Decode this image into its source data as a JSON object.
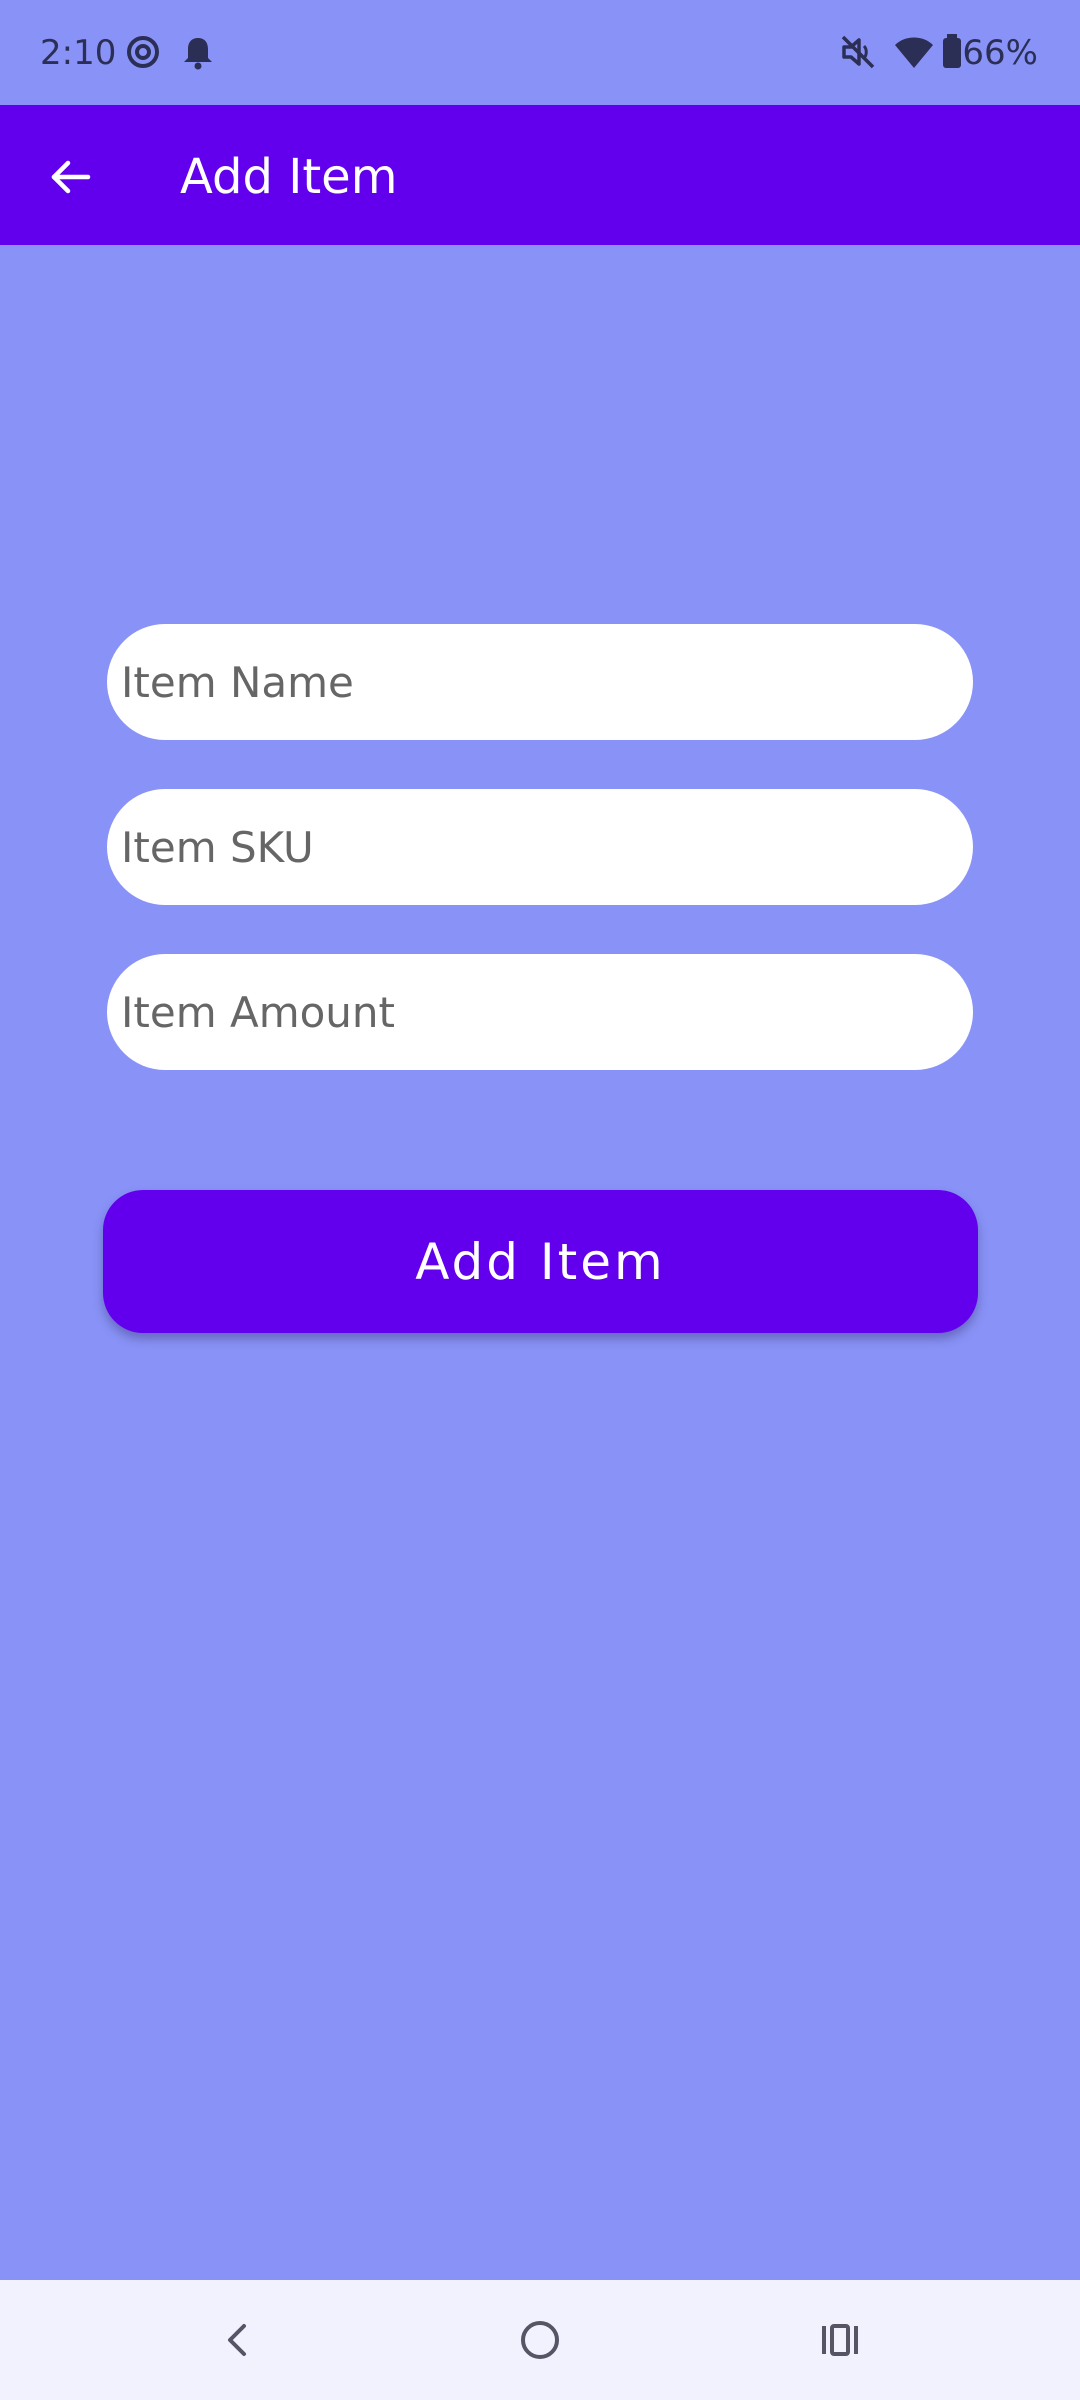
{
  "status_bar": {
    "time": "2:10",
    "battery_percent": "66%",
    "icons": [
      "at-sign-icon",
      "bell-icon",
      "mute-icon",
      "wifi-icon",
      "battery-icon"
    ]
  },
  "app_bar": {
    "title": "Add Item",
    "back_icon": "arrow-left-icon"
  },
  "form": {
    "item_name": {
      "value": "",
      "placeholder": "Item Name"
    },
    "item_sku": {
      "value": "",
      "placeholder": "Item SKU"
    },
    "item_amount": {
      "value": "",
      "placeholder": "Item Amount"
    },
    "submit_label": "Add Item"
  },
  "nav_bar": {
    "icons": [
      "back-chevron-icon",
      "home-circle-icon",
      "recents-icon"
    ]
  },
  "colors": {
    "background": "#8993f7",
    "primary": "#6200ee",
    "field_bg": "#ffffff",
    "nav_bg": "#f2f2ff",
    "status_text": "#2c2f55"
  }
}
